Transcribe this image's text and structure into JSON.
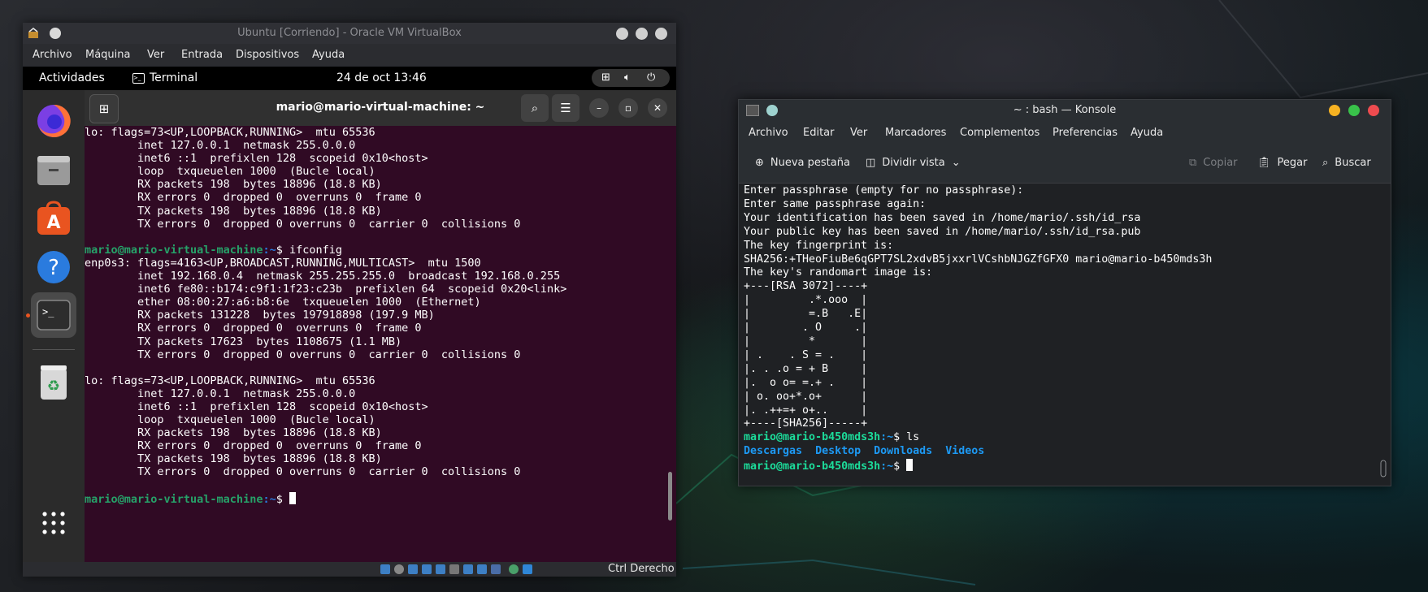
{
  "vbox": {
    "title": "Ubuntu [Corriendo] - Oracle VM VirtualBox",
    "menu": [
      "Archivo",
      "Máquina",
      "Ver",
      "Entrada",
      "Dispositivos",
      "Ayuda"
    ],
    "status_host_key": "Ctrl Derecho"
  },
  "ubuntu": {
    "activities": "Actividades",
    "app_name": "Terminal",
    "clock": "24 de oct  13:46",
    "terminal_title": "mario@mario-virtual-machine: ~",
    "dock": [
      "firefox-icon",
      "files-icon",
      "software-center-icon",
      "help-icon",
      "terminal-icon",
      "trash-icon",
      "app-grid-icon"
    ],
    "prompt_user": "mario@mario-virtual-machine",
    "prompt_path": ":~",
    "lines": [
      "lo: flags=73<UP,LOOPBACK,RUNNING>  mtu 65536",
      "        inet 127.0.0.1  netmask 255.0.0.0",
      "        inet6 ::1  prefixlen 128  scopeid 0x10<host>",
      "        loop  txqueuelen 1000  (Bucle local)",
      "        RX packets 198  bytes 18896 (18.8 KB)",
      "        RX errors 0  dropped 0  overruns 0  frame 0",
      "        TX packets 198  bytes 18896 (18.8 KB)",
      "        TX errors 0  dropped 0 overruns 0  carrier 0  collisions 0",
      "",
      "$ ifconfig",
      "enp0s3: flags=4163<UP,BROADCAST,RUNNING,MULTICAST>  mtu 1500",
      "        inet 192.168.0.4  netmask 255.255.255.0  broadcast 192.168.0.255",
      "        inet6 fe80::b174:c9f1:1f23:c23b  prefixlen 64  scopeid 0x20<link>",
      "        ether 08:00:27:a6:b8:6e  txqueuelen 1000  (Ethernet)",
      "        RX packets 131228  bytes 197918898 (197.9 MB)",
      "        RX errors 0  dropped 0  overruns 0  frame 0",
      "        TX packets 17623  bytes 1108675 (1.1 MB)",
      "        TX errors 0  dropped 0 overruns 0  carrier 0  collisions 0",
      "",
      "lo: flags=73<UP,LOOPBACK,RUNNING>  mtu 65536",
      "        inet 127.0.0.1  netmask 255.0.0.0",
      "        inet6 ::1  prefixlen 128  scopeid 0x10<host>",
      "        loop  txqueuelen 1000  (Bucle local)",
      "        RX packets 198  bytes 18896 (18.8 KB)",
      "        RX errors 0  dropped 0  overruns 0  frame 0",
      "        TX packets 198  bytes 18896 (18.8 KB)",
      "        TX errors 0  dropped 0 overruns 0  carrier 0  collisions 0",
      "",
      "$ "
    ]
  },
  "konsole": {
    "title": "~ : bash — Konsole",
    "menu": [
      "Archivo",
      "Editar",
      "Ver",
      "Marcadores",
      "Complementos",
      "Preferencias",
      "Ayuda"
    ],
    "toolbar": {
      "new_tab": "Nueva pestaña",
      "split_view": "Dividir vista",
      "copy": "Copiar",
      "paste": "Pegar",
      "search": "Buscar"
    },
    "prompt_user": "mario@mario-b450mds3h",
    "prompt_path": ":~",
    "lines": [
      "Enter passphrase (empty for no passphrase):",
      "Enter same passphrase again:",
      "Your identification has been saved in /home/mario/.ssh/id_rsa",
      "Your public key has been saved in /home/mario/.ssh/id_rsa.pub",
      "The key fingerprint is:",
      "SHA256:+THeoFiuBe6qGPT7SL2xdvB5jxxrlVCshbNJGZfGFX0 mario@mario-b450mds3h",
      "The key's randomart image is:",
      "+---[RSA 3072]----+",
      "|         .*.ooo  |",
      "|         =.B   .E|",
      "|        . O     .|",
      "|         *       |",
      "| .    . S = .    |",
      "|. . .o = + B     |",
      "|.  o o= =.+ .    |",
      "| o. oo+*.o+      |",
      "|. .++=+ o+..     |",
      "+----[SHA256]-----+",
      "$ ls",
      "",
      "$ "
    ],
    "ls_output": [
      "Descargas",
      "Desktop",
      "Downloads",
      "Videos"
    ]
  },
  "colors": {
    "ubuntu_terminal_bg": "#300a24",
    "ubuntu_prompt_user": "#26a269",
    "ubuntu_prompt_path": "#2a7bde",
    "konsole_bg": "#1f2124",
    "konsole_prompt": "#1cdc9a",
    "konsole_dir": "#1d99f3"
  }
}
